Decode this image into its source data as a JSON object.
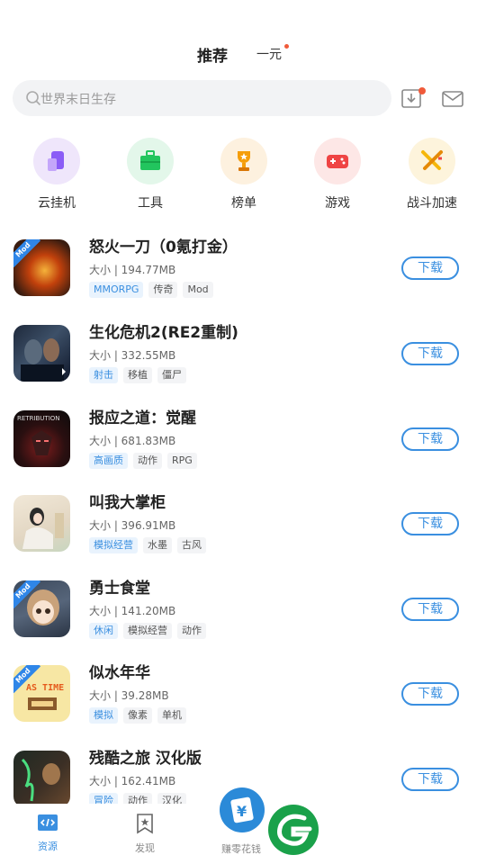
{
  "header": {
    "tab_main": "推荐",
    "tab_sub": "一元"
  },
  "search": {
    "placeholder": "世界末日生存"
  },
  "categories": [
    {
      "label": "云挂机",
      "icon": "cloud-phone-icon",
      "color": "#8b5cf6"
    },
    {
      "label": "工具",
      "icon": "toolbox-icon",
      "color": "#22c55e"
    },
    {
      "label": "榜单",
      "icon": "trophy-icon",
      "color": "#f59e0b"
    },
    {
      "label": "游戏",
      "icon": "gamepad-icon",
      "color": "#ef4444"
    },
    {
      "label": "战斗加速",
      "icon": "crossed-swords-icon",
      "color": "#f5b70b"
    }
  ],
  "apps": [
    {
      "name": "怒火一刀（0氪打金）",
      "size": "大小 | 194.77MB",
      "tags": [
        "MMORPG",
        "传奇",
        "Mod"
      ],
      "mod": true,
      "button": "下载"
    },
    {
      "name": "生化危机2(RE2重制)",
      "size": "大小 | 332.55MB",
      "tags": [
        "射击",
        "移植",
        "僵尸"
      ],
      "mod": false,
      "button": "下载"
    },
    {
      "name": "报应之道：觉醒",
      "size": "大小 | 681.83MB",
      "tags": [
        "高画质",
        "动作",
        "RPG"
      ],
      "mod": false,
      "button": "下载",
      "icon_text": "RETRIBUTION"
    },
    {
      "name": "叫我大掌柜",
      "size": "大小 | 396.91MB",
      "tags": [
        "模拟经营",
        "水墨",
        "古风"
      ],
      "mod": false,
      "button": "下载"
    },
    {
      "name": "勇士食堂",
      "size": "大小 | 141.20MB",
      "tags": [
        "休闲",
        "模拟经营",
        "动作"
      ],
      "mod": true,
      "button": "下载"
    },
    {
      "name": "似水年华",
      "size": "大小 | 39.28MB",
      "tags": [
        "模拟",
        "像素",
        "单机"
      ],
      "mod": true,
      "button": "下载",
      "icon_text": "AS TIME"
    },
    {
      "name": "残酷之旅  汉化版",
      "size": "大小 | 162.41MB",
      "tags": [
        "冒险",
        "动作",
        "汉化"
      ],
      "mod": false,
      "button": "下载"
    }
  ],
  "mod_badge": "Mod",
  "nav": {
    "resources": "资源",
    "discover": "发现",
    "earn": "赚零花钱"
  },
  "colors": {
    "accent": "#3a8fe0",
    "dot": "#f05a3a",
    "brand_green": "#1aa14a"
  }
}
